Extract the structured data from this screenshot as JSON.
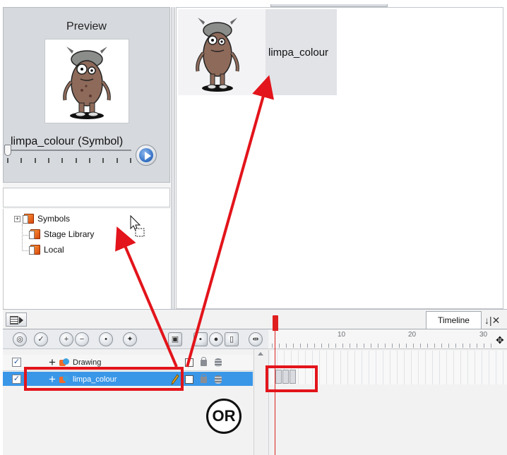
{
  "library_view": {
    "preview": {
      "title": "Preview",
      "symbol_name": "limpa_colour  (Symbol)",
      "play_button_icon": "play-icon"
    },
    "tree": {
      "items": [
        {
          "label": "Symbols",
          "icon": "symbols-folder-icon",
          "expandable": true
        },
        {
          "label": "Stage Library",
          "icon": "library-folder-icon",
          "expandable": false
        },
        {
          "label": "Local",
          "icon": "library-folder-icon",
          "expandable": false
        }
      ]
    },
    "thumbnail_view": {
      "items": [
        {
          "label": "limpa_colour"
        }
      ]
    }
  },
  "timeline_view": {
    "tab_label": "Timeline",
    "extra_tab_glyph": "↓|✕",
    "ruler": {
      "ticks": [
        "10",
        "20",
        "30"
      ],
      "end_glyph": "✥"
    },
    "layers": [
      {
        "name": "Drawing",
        "checked": true,
        "selected": false
      },
      {
        "name": "limpa_colour",
        "checked": true,
        "selected": true
      }
    ],
    "toolbar_icons": [
      "onion-skin-icon",
      "onion-skin-colour-icon",
      "add-layer-icon",
      "delete-layer-icon",
      "add-layer-group-icon",
      "add-effect-icon",
      "show-layer-icon",
      "thumbnails-icon",
      "lock-icon",
      "layer-mode-icon",
      "frame-marker-icon"
    ]
  },
  "annotation": {
    "or_label": "OR",
    "arrow_color": "#e3141b"
  },
  "colors": {
    "selection": "#3a97e8",
    "highlight": "#e3141b",
    "playhead": "#e02020"
  }
}
